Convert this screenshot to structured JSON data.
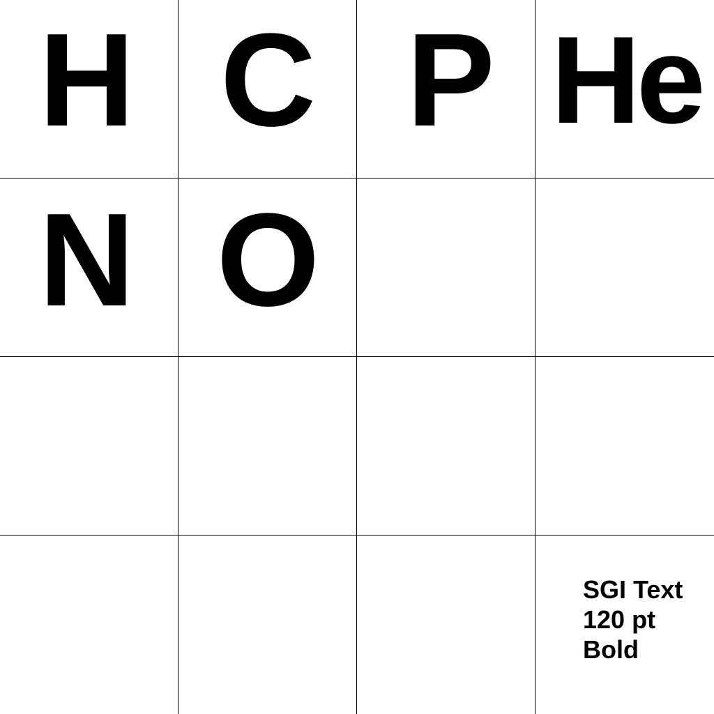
{
  "cells": [
    {
      "glyph": "H"
    },
    {
      "glyph": "C"
    },
    {
      "glyph": "P"
    },
    {
      "glyph": "He"
    },
    {
      "glyph": "N"
    },
    {
      "glyph": "O"
    }
  ],
  "caption": {
    "font_name": "SGI Text",
    "size": "120 pt",
    "weight": "Bold"
  },
  "colors": {
    "background": "#ffffff",
    "ink": "#000000",
    "grid_lines": "#000000"
  }
}
